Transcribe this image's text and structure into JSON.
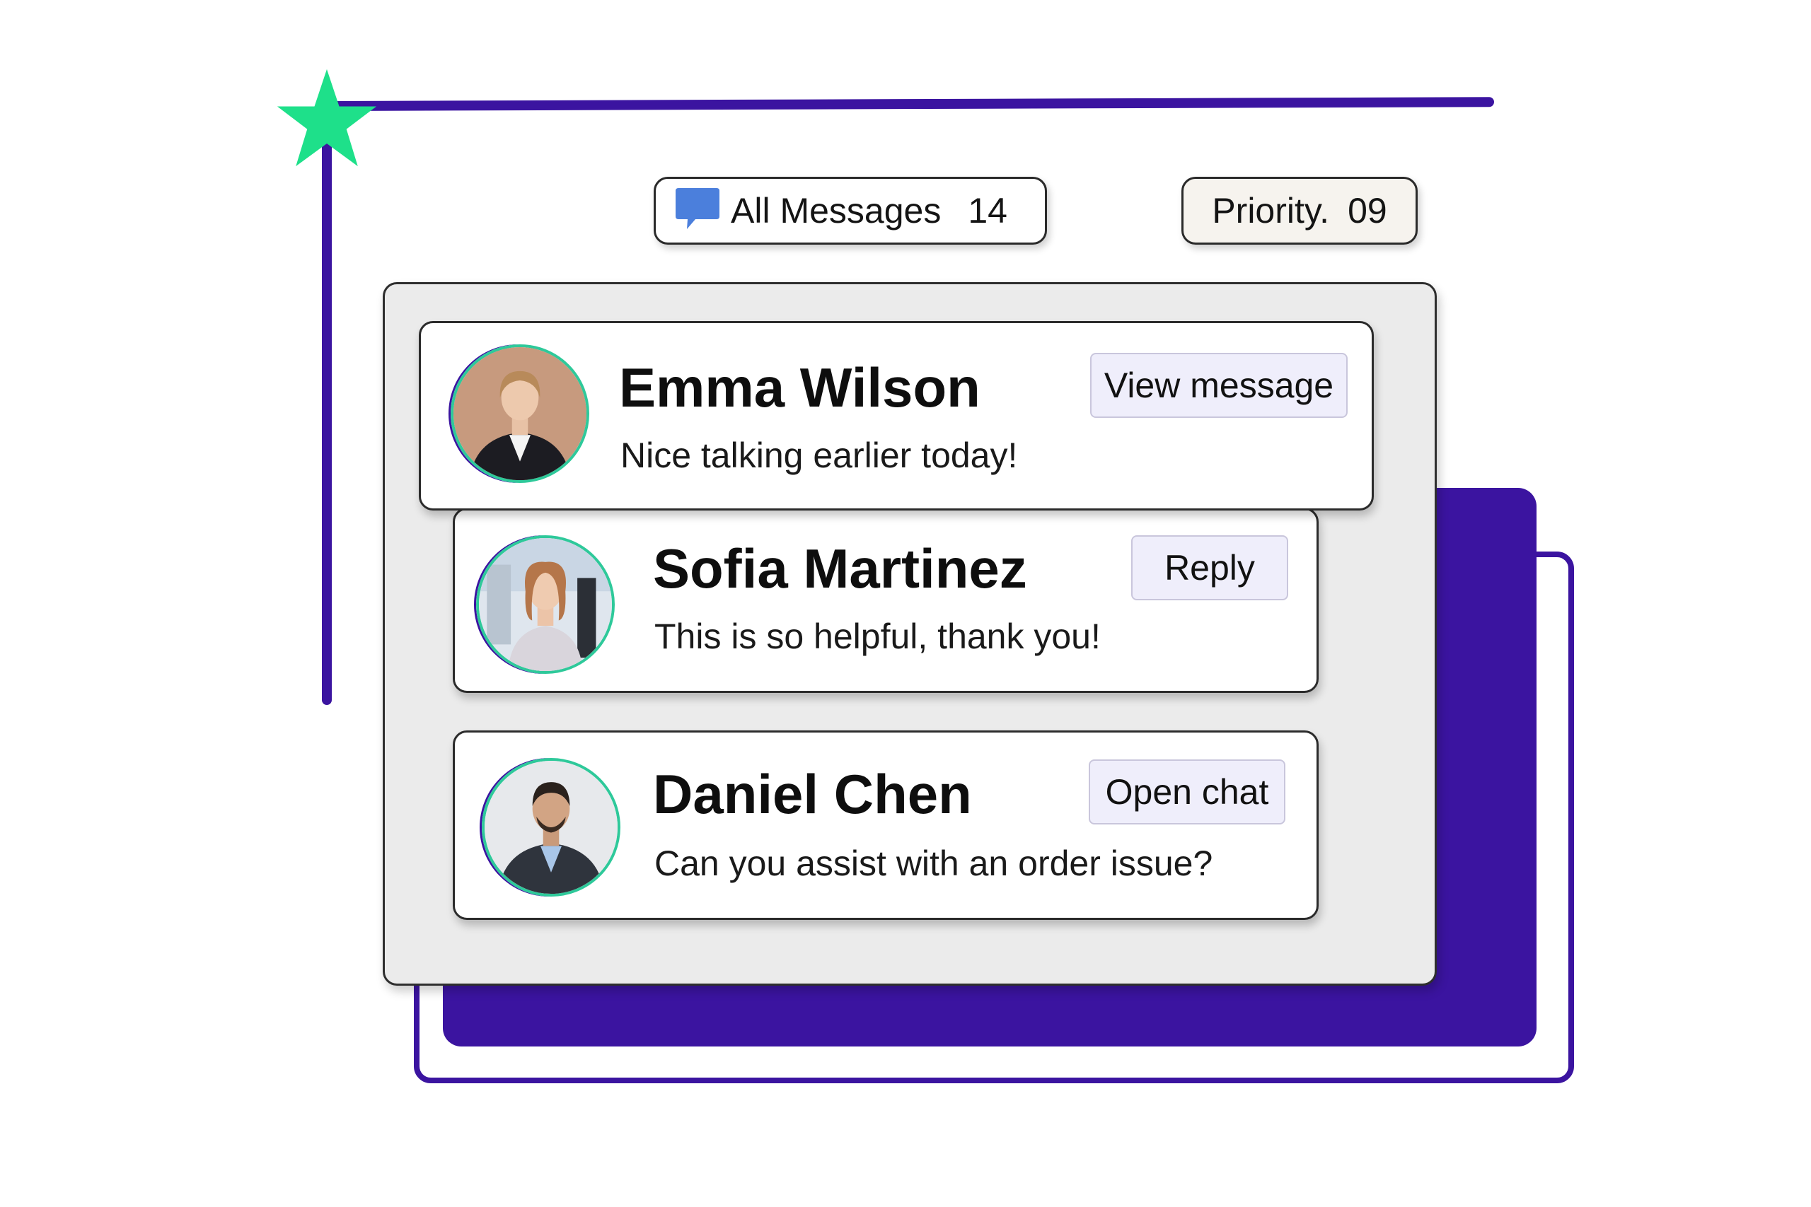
{
  "filters": {
    "all_messages": {
      "label": "All Messages",
      "count": "14",
      "icon": "chat-bubble-icon"
    },
    "priority": {
      "label": "Priority.",
      "count": "09"
    }
  },
  "messages": [
    {
      "name": "Emma Wilson",
      "snippet": "Nice talking earlier today!",
      "action": "View message"
    },
    {
      "name": "Sofia Martinez",
      "snippet": "This is so helpful, thank you!",
      "action": "Reply"
    },
    {
      "name": "Daniel Chen",
      "snippet": "Can you assist with an order issue?",
      "action": "Open chat"
    }
  ],
  "colors": {
    "accent_purple": "#3b14a0",
    "accent_green": "#1ee08a",
    "chat_icon_blue": "#4b7fdc",
    "panel_bg": "#ebebeb",
    "button_bg": "#efeefb"
  }
}
